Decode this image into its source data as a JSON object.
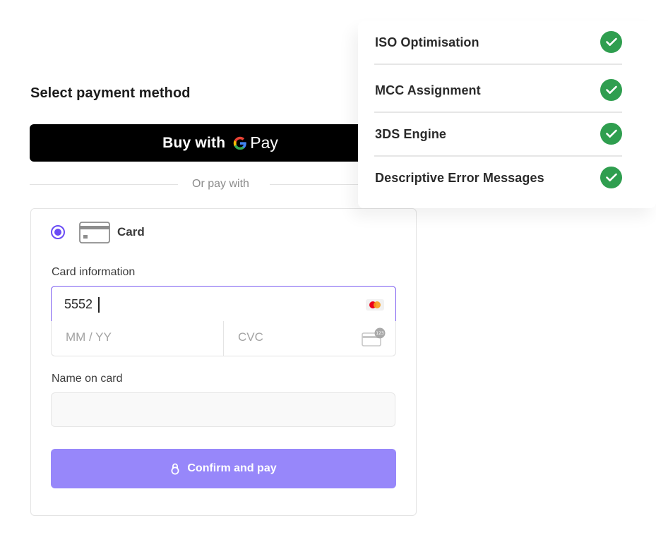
{
  "payment": {
    "title": "Select payment method",
    "gpay": {
      "buy_label": "Buy with",
      "pay_label": "Pay"
    },
    "divider_text": "Or pay with",
    "card_method_label": "Card",
    "card_info_label": "Card information",
    "card_number_value": "5552",
    "expiry_placeholder": "MM / YY",
    "cvc_placeholder": "CVC",
    "cvc_badge": "123",
    "name_label": "Name on card",
    "name_value": "",
    "confirm_label": "Confirm and pay"
  },
  "features": [
    {
      "label": "ISO Optimisation",
      "status": "checked"
    },
    {
      "label": "MCC Assignment",
      "status": "checked"
    },
    {
      "label": "3DS Engine",
      "status": "checked"
    },
    {
      "label": "Descriptive Error Messages",
      "status": "checked"
    }
  ],
  "colors": {
    "accent": "#6a4cf5",
    "confirm_button": "#9787fa",
    "check_green": "#2f9e4f",
    "gpay_background": "#000000"
  },
  "icons": {
    "google_logo": "google-g-icon",
    "card": "credit-card-icon",
    "card_brand": "mastercard-icon",
    "cvc": "cvc-card-icon",
    "lock": "lock-icon",
    "check": "check-circle-icon"
  }
}
